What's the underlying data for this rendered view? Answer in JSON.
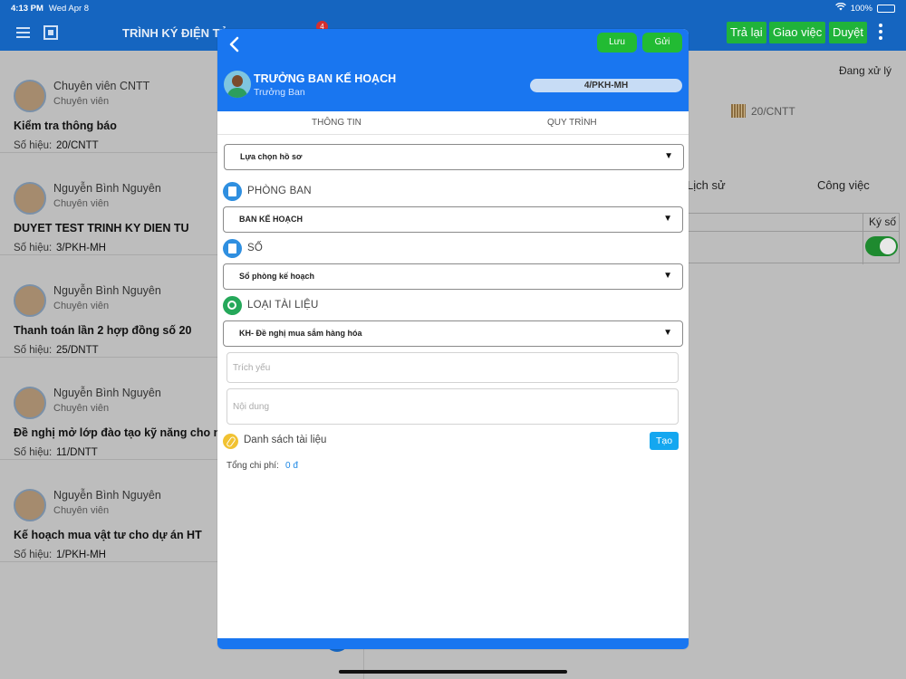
{
  "status_bar": {
    "time": "4:13 PM",
    "date": "Wed Apr 8",
    "battery": "100%"
  },
  "header": {
    "title": "TRÌNH KÝ ĐIỆN TỬ",
    "notification_count": "4",
    "actions": {
      "return": "Trả lại",
      "assign": "Giao việc",
      "approve": "Duyệt"
    }
  },
  "documents": [
    {
      "name": "Chuyên viên CNTT",
      "role": "Chuyên viên",
      "subject": "Kiểm tra thông báo",
      "code_label": "Số hiệu:",
      "code": "20/CNTT"
    },
    {
      "name": "Nguyễn Bình Nguyên",
      "role": "Chuyên viên",
      "subject": "DUYET TEST TRINH KY DIEN TU",
      "code_label": "Số hiệu:",
      "code": "3/PKH-MH"
    },
    {
      "name": "Nguyễn Bình Nguyên",
      "role": "Chuyên viên",
      "subject": "Thanh toán lần 2 hợp đồng số 20",
      "code_label": "Số hiệu:",
      "code": "25/DNTT"
    },
    {
      "name": "Nguyễn Bình Nguyên",
      "role": "Chuyên viên",
      "subject": "Đề nghị mở lớp đào tạo kỹ năng cho nhân viên",
      "code_label": "Số hiệu:",
      "code": "11/DNTT"
    },
    {
      "name": "Nguyễn Bình Nguyên",
      "role": "Chuyên viên",
      "subject": "Kế hoạch mua vật tư cho dự án HT",
      "code_label": "Số hiệu:",
      "code": "1/PKH-MH"
    }
  ],
  "detail": {
    "status": "Đang xử lý",
    "code": "20/CNTT",
    "tab_history": "Lịch sử",
    "tab_work": "Công việc",
    "sign_column": "Ký số"
  },
  "modal": {
    "save_label": "Lưu",
    "send_label": "Gửi",
    "user_name": "TRƯỞNG BAN KẾ HOẠCH",
    "user_role": "Trưởng Ban",
    "doc_code": "4/PKH-MH",
    "tab_info": "THÔNG TIN",
    "tab_process": "QUY TRÌNH",
    "profile_select": "Lựa chọn hồ sơ",
    "department_label": "PHÒNG BAN",
    "department_value": "BAN KẾ HOẠCH",
    "book_label": "SỐ",
    "book_value": "Sổ phòng kế hoạch",
    "doctype_label": "LOẠI TÀI LIỆU",
    "doctype_value": "KH- Đề nghị mua sắm hàng hóa",
    "summary_placeholder": "Trích yếu",
    "content_placeholder": "Nội dung",
    "docs_label": "Danh sách tài liệu",
    "create_label": "Tạo",
    "total_label": "Tổng chi phí:",
    "total_value": "0 đ"
  },
  "colors": {
    "primary": "#1976f0",
    "header_blue": "#1565c0",
    "green": "#22bb33",
    "cyan": "#14a7f0",
    "accent_value": "#1e88e5"
  }
}
